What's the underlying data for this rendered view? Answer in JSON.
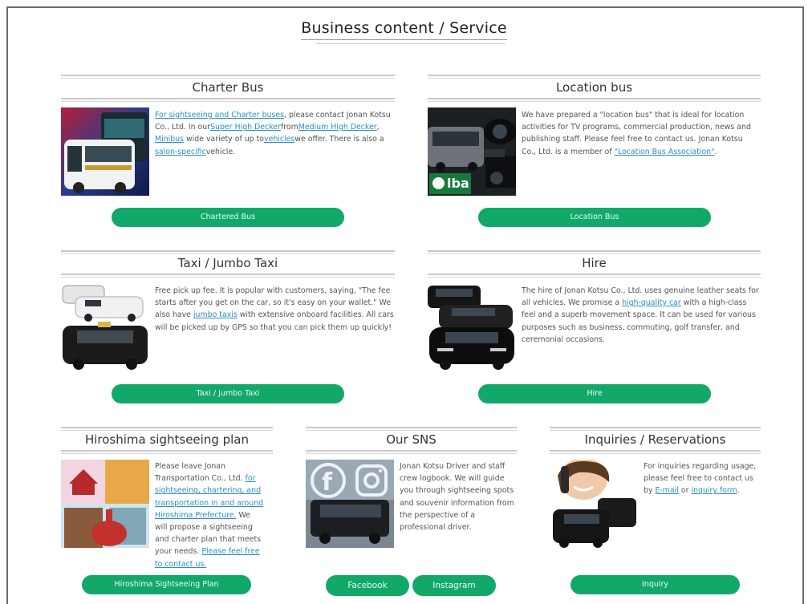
{
  "page": {
    "title": "Business content / Service"
  },
  "charter": {
    "title": "Charter Bus",
    "desc": {
      "l1": "For sightseeing and Charter buses",
      "t1": ", please contact Jonan Kotsu Co., Ltd. In our",
      "l2": "Super High Decker",
      "t2": "from",
      "l3": "Medium High Decker",
      "t3": ", ",
      "l4": "Minibus",
      "t4": " wide variety of up to",
      "l5": "vehicles",
      "t5": "we offer. There is also a ",
      "l6": "salon-specific",
      "t6": "vehicle."
    },
    "button": "Chartered Bus"
  },
  "location": {
    "title": "Location bus",
    "desc": {
      "t1": "We have prepared a \"location bus\" that is ideal for location activities for TV programs, commercial production, news and publishing staff. Please feel free to contact us. Jonan Kotsu Co., Ltd. is a member of ",
      "l1": "\"Location Bus Association\"",
      "t2": "."
    },
    "badge": "lba",
    "button": "Location Bus"
  },
  "taxi": {
    "title": "Taxi / Jumbo Taxi",
    "desc": {
      "t1": "Free pick up fee. It is popular with customers, saying, \"The fee starts after you get on the car, so it's easy on your wallet.\" We also have ",
      "l1": "jumbo taxis",
      "t2": " with extensive onboard facilities. All cars will be picked up by GPS so that you can pick them up quickly!"
    },
    "button": "Taxi / Jumbo Taxi"
  },
  "hire": {
    "title": "Hire",
    "desc": {
      "t1": "The hire of Jonan Kotsu Co., Ltd. uses genuine leather seats for all vehicles. We promise a ",
      "l1": "high-quality car",
      "t2": " with a high-class feel and a superb movement space. It can be used for various purposes such as business, commuting, golf transfer, and ceremonial occasions."
    },
    "button": "Hire"
  },
  "hiroshima": {
    "title": "Hiroshima sightseeing plan",
    "desc": {
      "t1": "Please leave Jonan Transportation Co., Ltd. ",
      "l1": "for sightseeing, chartering, and transportation in and around Hiroshima Prefecture.",
      "t2": " We will propose a sightseeing and charter plan that meets your needs. ",
      "l2": "Please feel free to contact us."
    },
    "button": "Hiroshima Sightseeing Plan"
  },
  "sns": {
    "title": "Our SNS",
    "desc": "Jonan Kotsu Driver and staff crew logbook. We will guide you through sightseeing spots and souvenir information from the perspective of a professional driver.",
    "facebook_button": "Facebook",
    "instagram_button": "Instagram"
  },
  "inquiry": {
    "title": "Inquiries / Reservations",
    "desc": {
      "t1": "For inquiries regarding usage, please feel free to contact us by ",
      "l1": "E-mail",
      "t2": " or ",
      "l2": "inquiry form",
      "t3": "."
    },
    "button": "Inquiry"
  },
  "colors": {
    "accent": "#12a86a",
    "link": "#2a8fc8",
    "border": "#6b6b6b"
  }
}
